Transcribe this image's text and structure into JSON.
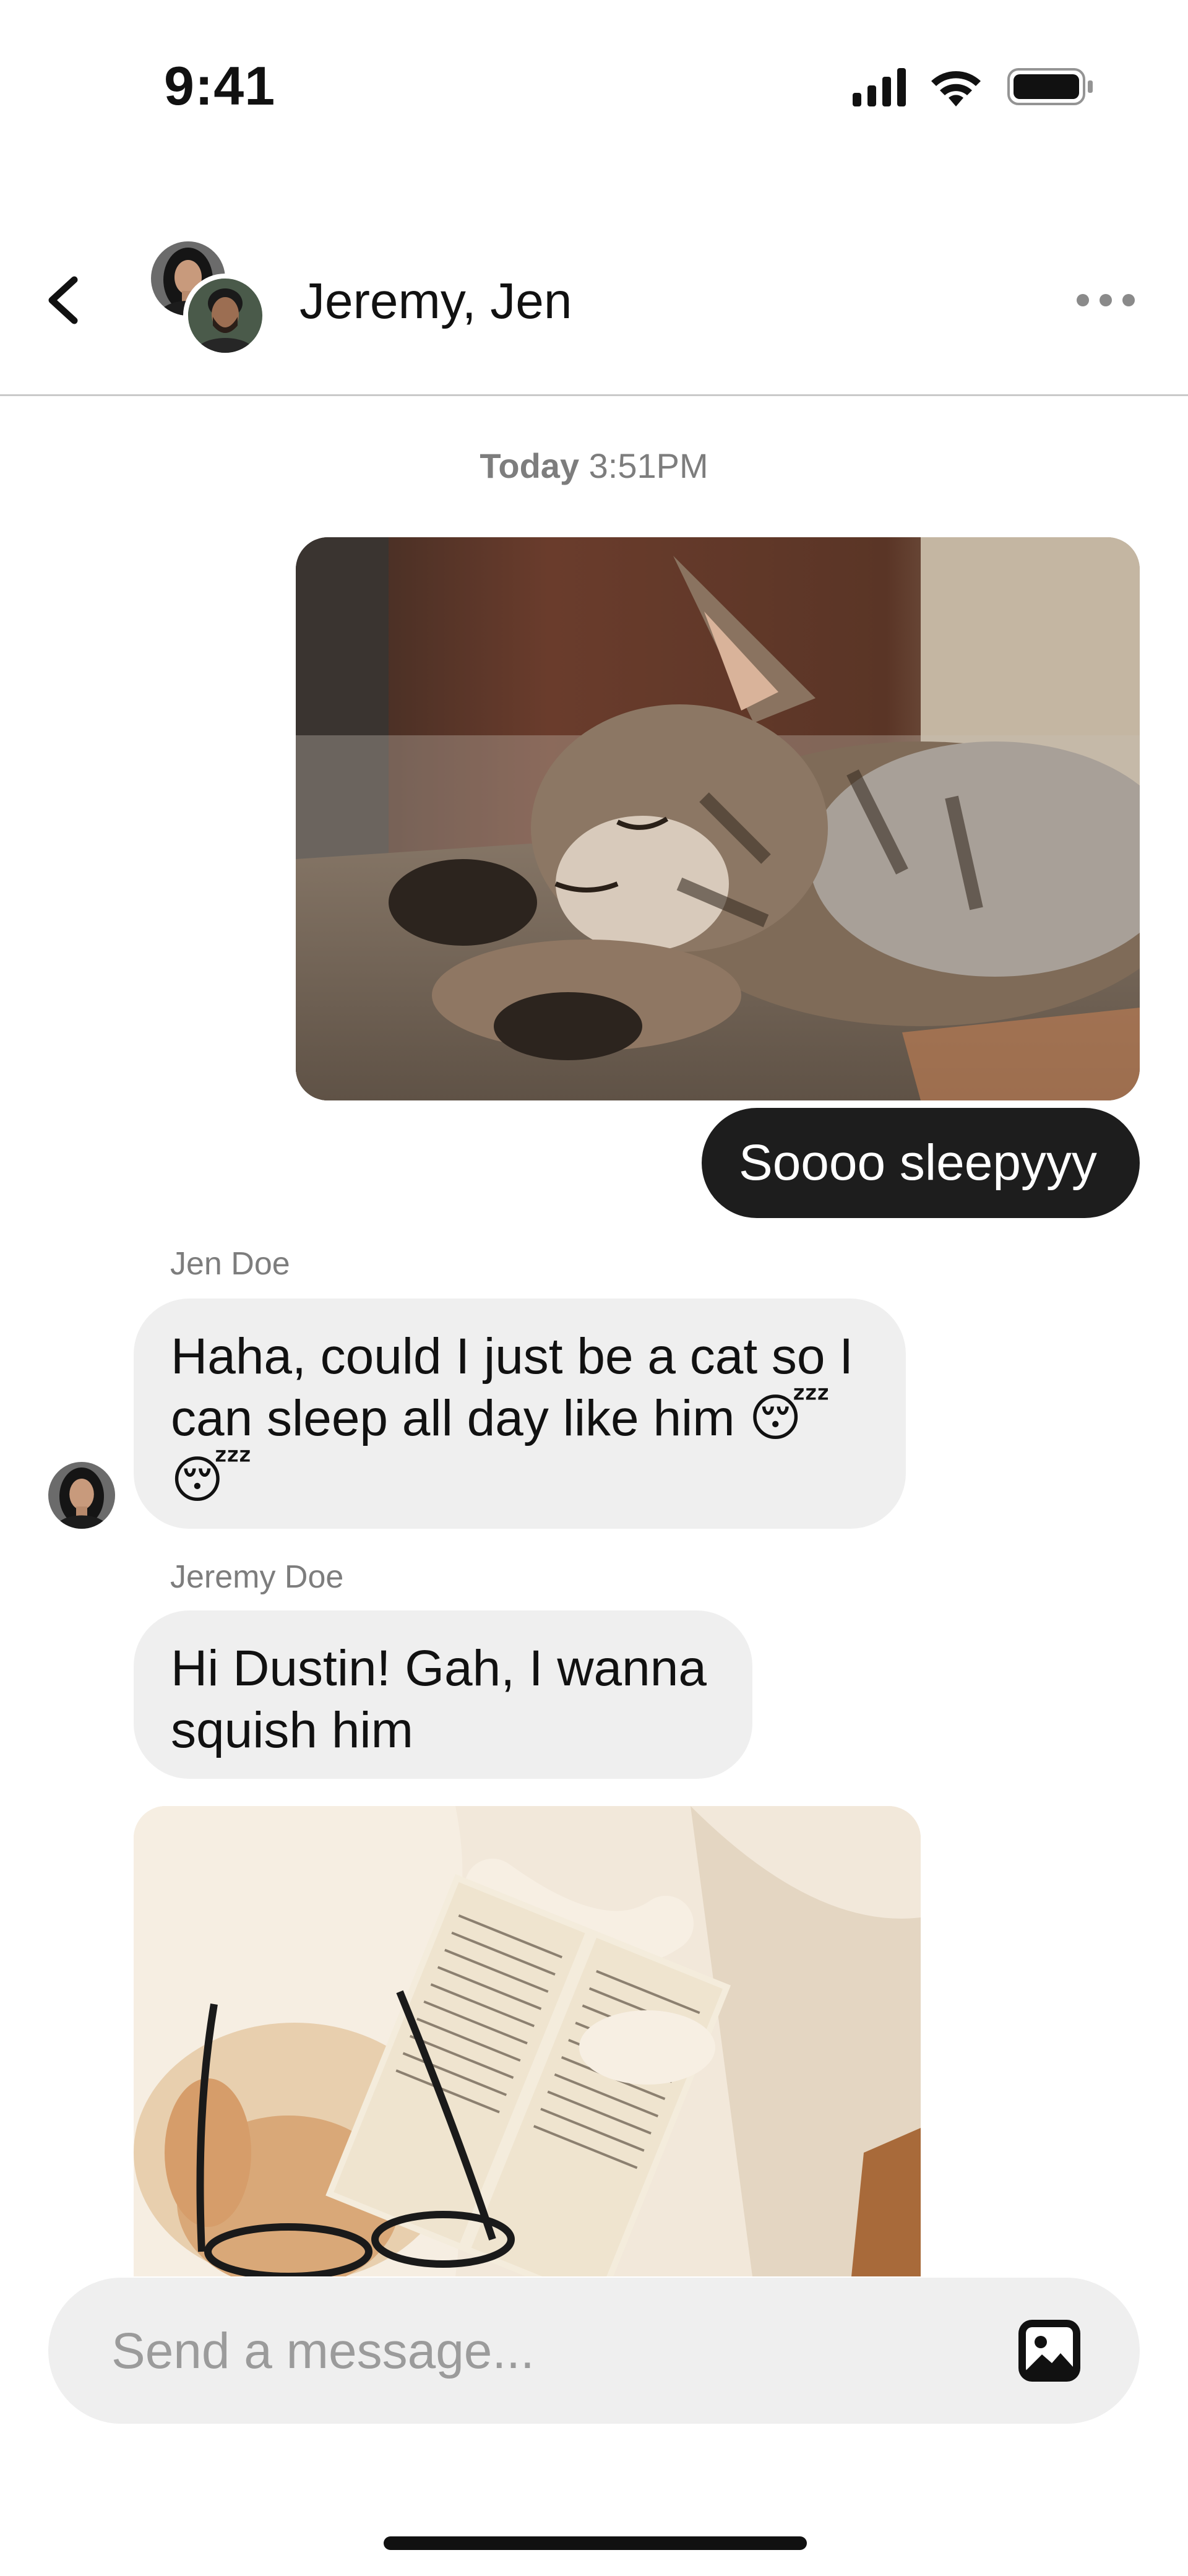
{
  "status_bar": {
    "time": "9:41",
    "icons": [
      "cellular-signal-icon",
      "wifi-icon",
      "battery-icon"
    ]
  },
  "header": {
    "back_icon": "chevron-left-icon",
    "title": "Jeremy, Jen",
    "avatars": [
      "Jen Doe",
      "Jeremy Doe"
    ],
    "more_icon": "more-horizontal-icon"
  },
  "conversation": {
    "timestamp_day": "Today",
    "timestamp_time": "3:51PM",
    "messages": [
      {
        "type": "image",
        "direction": "outgoing",
        "content": "sleeping-kitten-photo"
      },
      {
        "type": "text",
        "direction": "outgoing",
        "text": "Soooo sleepyyy"
      },
      {
        "type": "text",
        "direction": "incoming",
        "sender": "Jen Doe",
        "lines": [
          "Haha, could I just be a cat so I",
          "can sleep all day like him 😴",
          "😴"
        ]
      },
      {
        "type": "text",
        "direction": "incoming",
        "sender": "Jeremy Doe",
        "lines": [
          "Hi Dustin! Gah, I wanna",
          "squish him"
        ]
      },
      {
        "type": "image",
        "direction": "incoming",
        "content": "dog-with-glasses-and-book-photo"
      }
    ]
  },
  "composer": {
    "placeholder": "Send a message...",
    "value": "",
    "attach_icon": "image-icon"
  },
  "colors": {
    "outgoing_bubble": "#1d1d1d",
    "incoming_bubble": "#efefef",
    "muted_text": "#7d7d7d",
    "divider": "#c9c9c9"
  }
}
